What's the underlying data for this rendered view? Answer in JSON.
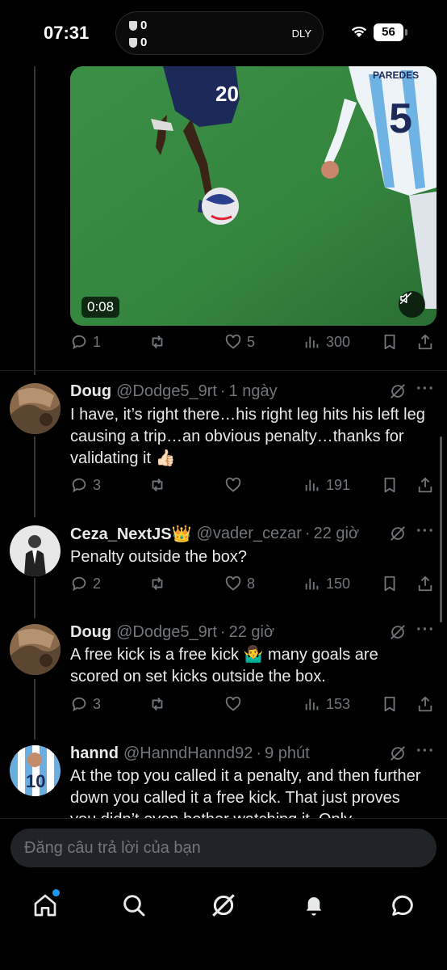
{
  "status_bar": {
    "time": "07:31",
    "score_home": "0",
    "score_away": "0",
    "island_label": "DLY",
    "battery": "56"
  },
  "video": {
    "duration": "0:08",
    "player_number": "20",
    "jersey_name": "PAREDES",
    "jersey_number": "5"
  },
  "main_post": {
    "replies": "1",
    "likes": "5",
    "views": "300"
  },
  "replies": [
    {
      "name": "Doug",
      "handle": "@Dodge5_9rt",
      "time": "1 ngày",
      "text": "I have, it’s right there…his right leg hits his left leg causing a trip…an obvious penalty…thanks for validating it 👍🏻",
      "replies": "3",
      "likes": "",
      "views": "191"
    },
    {
      "name": "Ceza_NextJS👑",
      "handle": "@vader_cezar",
      "time": "22 giờ",
      "text": "Penalty outside the box?",
      "replies": "2",
      "likes": "8",
      "views": "150"
    },
    {
      "name": "Doug",
      "handle": "@Dodge5_9rt",
      "time": "22 giờ",
      "text": "A free kick is a free kick 🤷‍♂️ many goals are scored on set kicks outside the box.",
      "replies": "3",
      "likes": "",
      "views": "153"
    },
    {
      "name": "hannd",
      "handle": "@HanndHannd92",
      "time": "9 phút",
      "text": "At the top you called it a penalty, and then further down you called it a free kick. That just proves you didn’t even bother watching it. Only"
    }
  ],
  "composer": {
    "placeholder": "Đăng câu trả lời của bạn"
  },
  "nav": {
    "items": [
      "home-icon",
      "search-icon",
      "grok-icon",
      "notifications-icon",
      "messages-icon"
    ],
    "accent": "#1d9bf0"
  },
  "colors": {
    "background": "#000000",
    "text": "#e7e9ea",
    "muted": "#71767b",
    "accent": "#1d9bf0"
  }
}
